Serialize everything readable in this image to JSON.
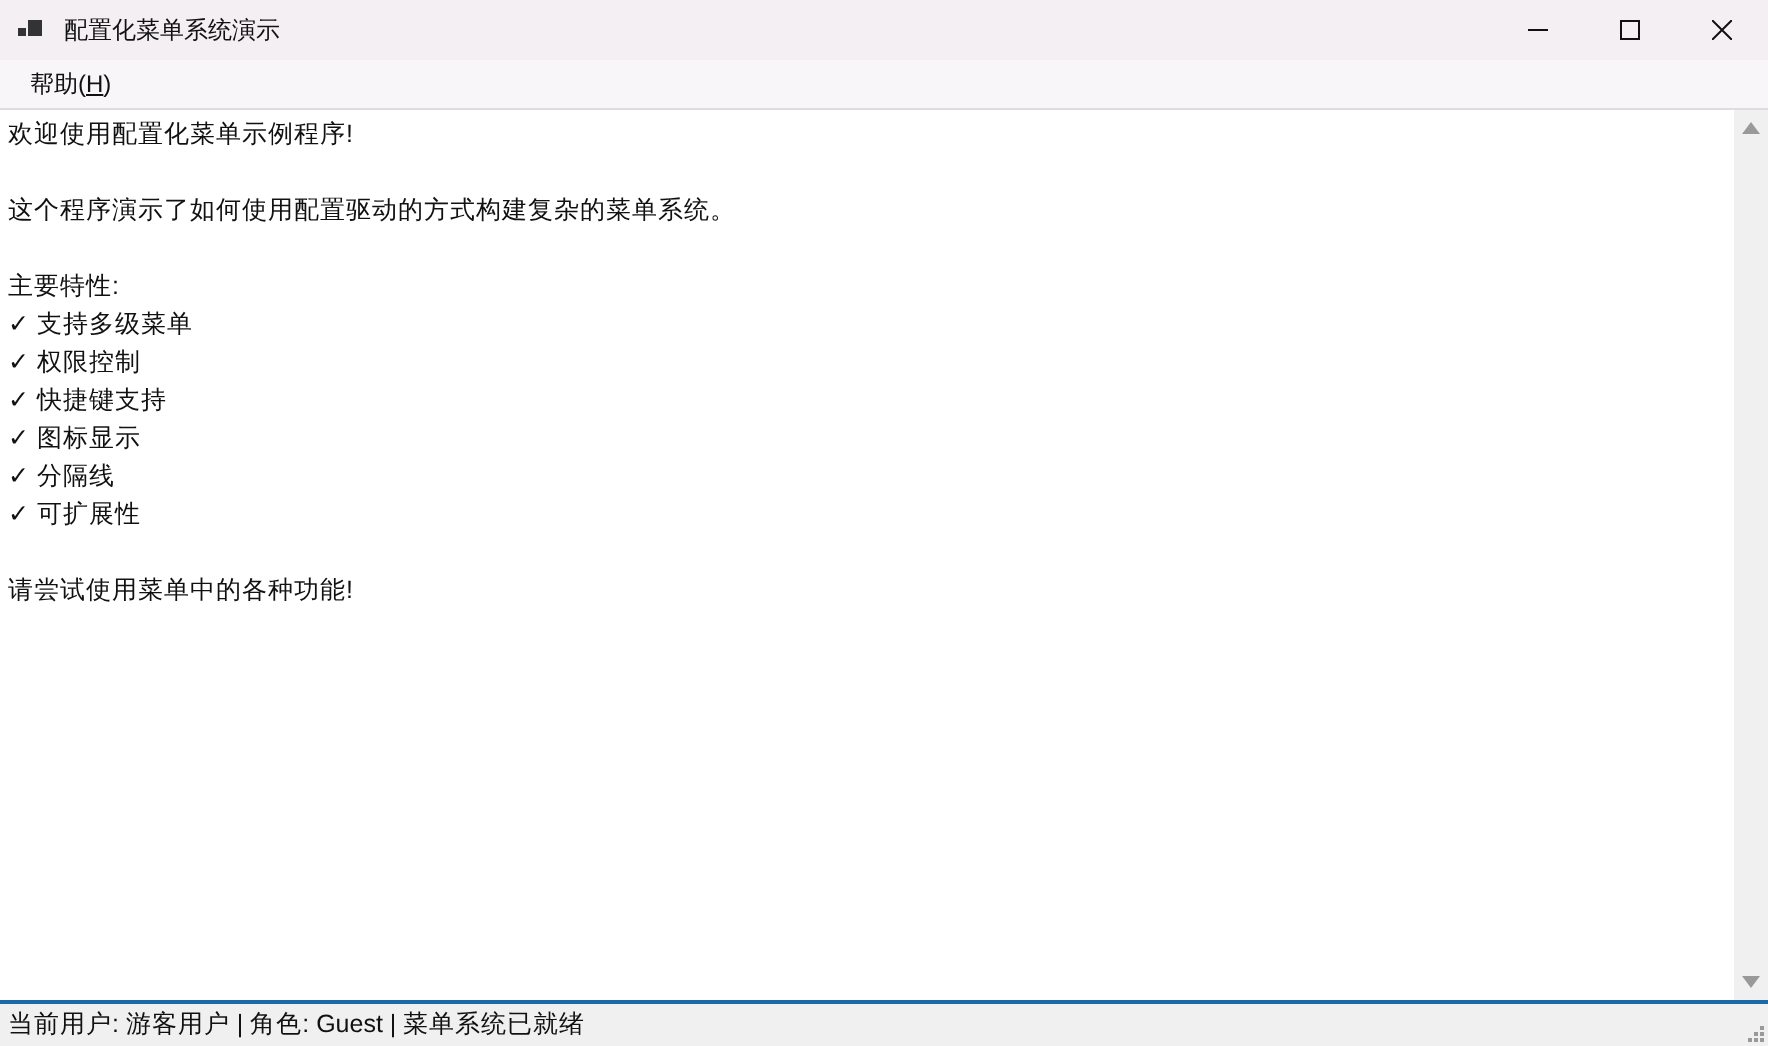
{
  "window": {
    "title": "配置化菜单系统演示"
  },
  "menu_bar": [
    {
      "label_before": "帮助(",
      "access_key": "H",
      "label_after": ")"
    }
  ],
  "text_area": {
    "paragraphs": [
      {
        "lines": [
          "欢迎使用配置化菜单示例程序!"
        ]
      },
      {
        "lines": [
          "这个程序演示了如何使用配置驱动的方式构建复杂的菜单系统。"
        ]
      },
      {
        "lines": [
          "主要特性:",
          "✓ 支持多级菜单",
          "✓ 权限控制",
          "✓ 快捷键支持",
          "✓ 图标显示",
          "✓ 分隔线",
          "✓ 可扩展性"
        ]
      },
      {
        "lines": [
          "请尝试使用菜单中的各种功能!"
        ]
      }
    ]
  },
  "status_bar": {
    "text": "当前用户: 游客用户 | 角色: Guest | 菜单系统已就绪"
  }
}
